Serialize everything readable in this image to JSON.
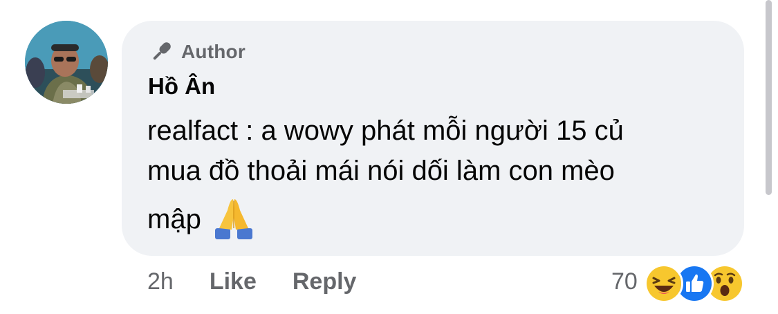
{
  "comment": {
    "author_badge": "Author",
    "author_name": "Hồ Ân",
    "text_lines": [
      "realfact : a wowy phát mỗi người 15 củ",
      "mua đồ thoải mái nói dối làm con mèo",
      "mập"
    ],
    "emoji": "folded-hands"
  },
  "actions": {
    "time": "2h",
    "like_label": "Like",
    "reply_label": "Reply"
  },
  "reactions": {
    "count": "70",
    "types": [
      "haha",
      "like",
      "wow"
    ]
  },
  "colors": {
    "bubble": "#f0f2f5",
    "secondary_text": "#65676b",
    "primary_text": "#050505",
    "like_blue": "#1877f2"
  }
}
